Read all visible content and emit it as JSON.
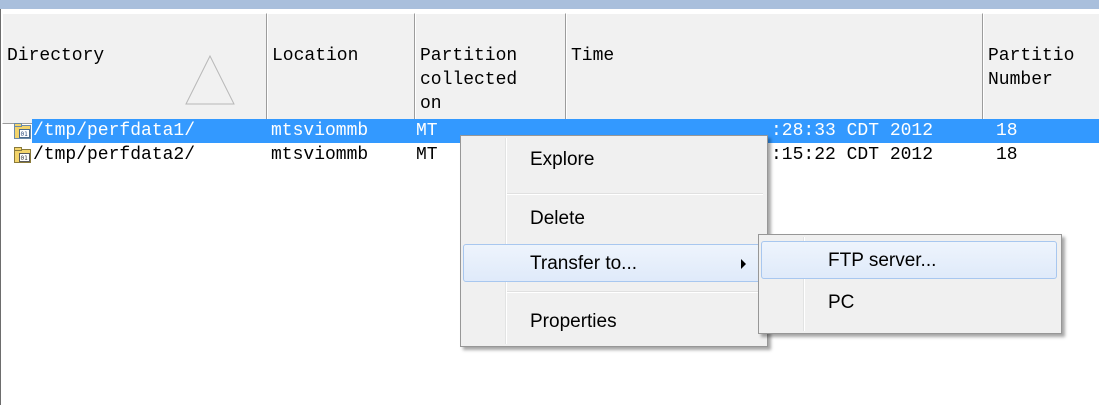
{
  "columns": [
    {
      "label": "Directory"
    },
    {
      "label": "Location"
    },
    {
      "label": "Partition\ncollected\non"
    },
    {
      "label": "Time"
    },
    {
      "label": "Partitio\nNumber"
    }
  ],
  "rows": [
    {
      "directory": "/tmp/perfdata1/",
      "location": "mtsviommb",
      "partition": "MT",
      "time": ":28:33 CDT 2012",
      "number": "18",
      "selected": true
    },
    {
      "directory": "/tmp/perfdata2/",
      "location": "mtsviommb",
      "partition": "MT",
      "time": ":15:22 CDT 2012",
      "number": "18",
      "selected": false
    }
  ],
  "context_menu": {
    "items": [
      {
        "label": "Explore"
      },
      {
        "label": "Delete"
      },
      {
        "label": "Transfer to..."
      },
      {
        "label": "Properties"
      }
    ]
  },
  "submenu": {
    "items": [
      {
        "label": "FTP server..."
      },
      {
        "label": "PC"
      }
    ]
  },
  "colors": {
    "selection": "#3399ff",
    "menu_bg": "#f0f0f0",
    "hover_border": "#a8c7ef"
  },
  "icons": {
    "row_icon": "folder-data-icon",
    "sort": "sort-triangle-icon",
    "submenu": "submenu-arrow-icon"
  }
}
